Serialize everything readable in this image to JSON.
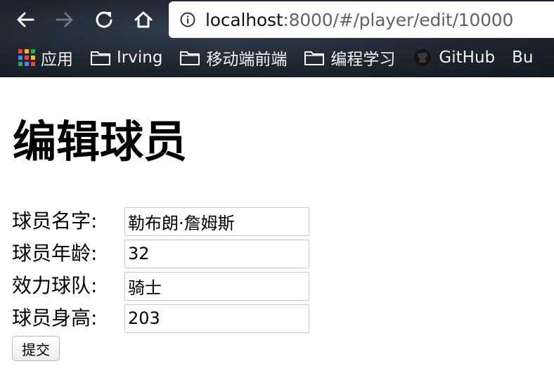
{
  "browser": {
    "url_host": "localhost",
    "url_path": ":8000/#/player/edit/10000",
    "nav": {
      "back_icon": "arrow-left-icon",
      "forward_icon": "arrow-right-icon",
      "reload_icon": "reload-icon",
      "home_icon": "home-icon"
    },
    "bookmarks": [
      {
        "label": "应用",
        "icon": "apps-grid-icon"
      },
      {
        "label": "Irving",
        "icon": "folder-icon"
      },
      {
        "label": "移动端前端",
        "icon": "folder-icon"
      },
      {
        "label": "编程学习",
        "icon": "folder-icon"
      },
      {
        "label": "GitHub",
        "icon": "github-icon"
      },
      {
        "label": "Bu",
        "icon": ""
      }
    ]
  },
  "page": {
    "title": "编辑球员",
    "fields": [
      {
        "label": "球员名字:",
        "value": "勒布朗·詹姆斯"
      },
      {
        "label": "球员年龄:",
        "value": "32"
      },
      {
        "label": "效力球队:",
        "value": "骑士"
      },
      {
        "label": "球员身高:",
        "value": "203"
      }
    ],
    "submit_label": "提交"
  },
  "colors": {
    "apps_grid": [
      "#ea4335",
      "#fbbc05",
      "#34a853",
      "#4285f4",
      "#ea4335",
      "#fbbc05",
      "#34a853",
      "#4285f4",
      "#ea4335"
    ]
  }
}
